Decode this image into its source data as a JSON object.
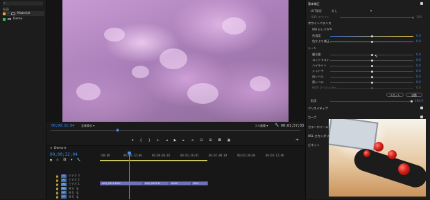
{
  "project": {
    "search_icon": "search-icon",
    "column_name": "名前",
    "items": [
      {
        "name": "Material",
        "swatch": "#e8a33a",
        "type": "folder"
      },
      {
        "name": "Demo",
        "swatch": "#35c04a",
        "type": "sequence"
      }
    ]
  },
  "viewer": {
    "timecode_left": "00;00;32;04",
    "fit_label": "全体表示",
    "quality_label": "フル画質",
    "timecode_right": "00;01;57;03"
  },
  "timeline": {
    "tab_name": "Demo",
    "timecode": "00;00;32;04",
    "ruler_labels": [
      ":00;00",
      "00;00;32;00",
      "00;00;04;02",
      "00;01;36;02",
      "00;02;08;04",
      "00;02;40;04",
      "00;03;12;06"
    ],
    "tracks": [
      {
        "id": "V3",
        "name": "ビデオ 3"
      },
      {
        "id": "V2",
        "name": "ビデオ 2"
      },
      {
        "id": "V1",
        "name": "ビデオ 1"
      },
      {
        "id": "A1",
        "name": "M S"
      },
      {
        "id": "A2",
        "name": "M S"
      },
      {
        "id": "A3",
        "name": "M S"
      }
    ],
    "clips": [
      {
        "label": "A04_0031.MOV"
      },
      {
        "label": "A04_0032.M"
      },
      {
        "label": "A04C"
      },
      {
        "label": "A04"
      }
    ]
  },
  "lumetri": {
    "basic_correction": "基本補正",
    "lut_label": "LUT設定",
    "lut_value": "なし",
    "hdr_label": "HDR ホワイト",
    "hdr_value": "100",
    "white_balance": "ホワイトバランス",
    "wb_selector": "WB セレクター",
    "temperature_label": "色温度",
    "temperature_value": "0.0",
    "tint_label": "色かぶり補正",
    "tint_value": "0.0",
    "tone": "トーン",
    "sliders": [
      {
        "label": "露光量",
        "value": "0.0",
        "level": 0.5
      },
      {
        "label": "コントラスト",
        "value": "0.0",
        "level": 0.5
      },
      {
        "label": "ハイライト",
        "value": "0.0",
        "level": 0.5
      },
      {
        "label": "シャドウ",
        "value": "0.0",
        "level": 0.5
      },
      {
        "label": "白レベル",
        "value": "0.0",
        "level": 0.5
      },
      {
        "label": "黒レベル",
        "value": "0.0",
        "level": 0.5
      },
      {
        "label": "HDR スペキュラー",
        "value": "0.0",
        "level": 0.5
      }
    ],
    "reset_button": "リセット",
    "auto_button": "自動",
    "saturation_label": "彩度",
    "saturation_value": "100.0",
    "creative": "クリエイティブ",
    "curves": "カーブ",
    "color_wheels": "カラーホイール",
    "hsl": "HSL セカンダリ",
    "vignette": "ビネット"
  }
}
